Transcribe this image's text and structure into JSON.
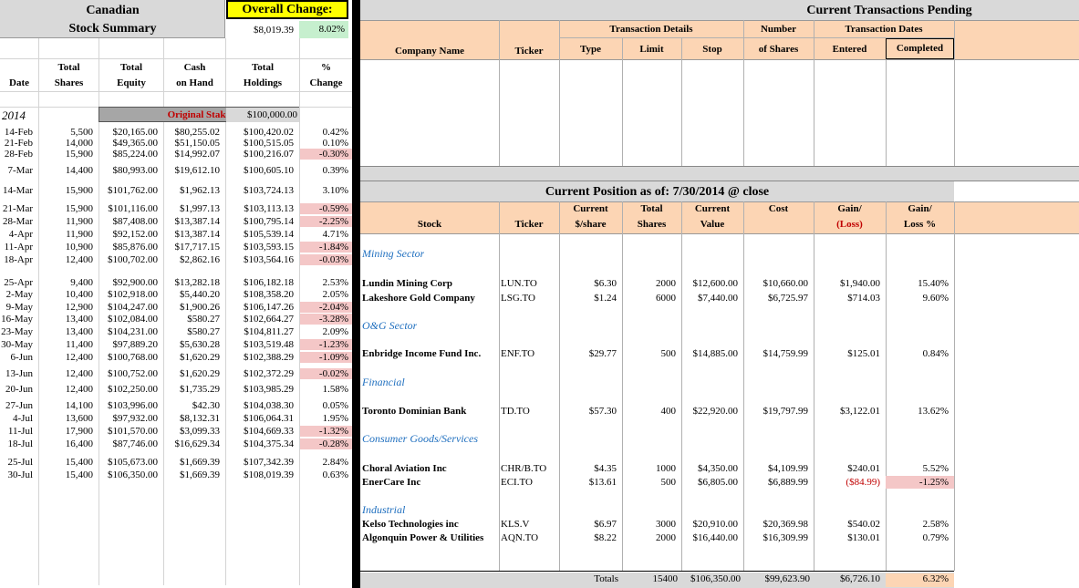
{
  "summary": {
    "title_line1": "Canadian",
    "title_line2": "Stock Summary",
    "overall_label": "Overall Change:",
    "overall_value": "$8,019.39",
    "overall_pct": "8.02%",
    "headers": {
      "date": "Date",
      "shares1": "Total",
      "shares2": "Shares",
      "equity1": "Total",
      "equity2": "Equity",
      "cash1": "Cash",
      "cash2": "on Hand",
      "holdings1": "Total",
      "holdings2": "Holdings",
      "pct1": "%",
      "pct2": "Change"
    },
    "year": "2014",
    "stake_label": "Original Stake:",
    "stake_value": "$100,000.00",
    "rows": [
      {
        "date": "14-Feb",
        "shares": "5,500",
        "equity": "$20,165.00",
        "cash": "$80,255.02",
        "holdings": "$100,420.02",
        "pct": "0.42%",
        "neg": false
      },
      {
        "date": "21-Feb",
        "shares": "14,000",
        "equity": "$49,365.00",
        "cash": "$51,150.05",
        "holdings": "$100,515.05",
        "pct": "0.10%",
        "neg": false
      },
      {
        "date": "28-Feb",
        "shares": "15,900",
        "equity": "$85,224.00",
        "cash": "$14,992.07",
        "holdings": "$100,216.07",
        "pct": "-0.30%",
        "neg": true
      },
      {
        "date": "7-Mar",
        "shares": "14,400",
        "equity": "$80,993.00",
        "cash": "$19,612.10",
        "holdings": "$100,605.10",
        "pct": "0.39%",
        "neg": false
      },
      {
        "date": "14-Mar",
        "shares": "15,900",
        "equity": "$101,762.00",
        "cash": "$1,962.13",
        "holdings": "$103,724.13",
        "pct": "3.10%",
        "neg": false
      },
      {
        "date": "21-Mar",
        "shares": "15,900",
        "equity": "$101,116.00",
        "cash": "$1,997.13",
        "holdings": "$103,113.13",
        "pct": "-0.59%",
        "neg": true
      },
      {
        "date": "28-Mar",
        "shares": "11,900",
        "equity": "$87,408.00",
        "cash": "$13,387.14",
        "holdings": "$100,795.14",
        "pct": "-2.25%",
        "neg": true
      },
      {
        "date": "4-Apr",
        "shares": "11,900",
        "equity": "$92,152.00",
        "cash": "$13,387.14",
        "holdings": "$105,539.14",
        "pct": "4.71%",
        "neg": false
      },
      {
        "date": "11-Apr",
        "shares": "10,900",
        "equity": "$85,876.00",
        "cash": "$17,717.15",
        "holdings": "$103,593.15",
        "pct": "-1.84%",
        "neg": true
      },
      {
        "date": "18-Apr",
        "shares": "12,400",
        "equity": "$100,702.00",
        "cash": "$2,862.16",
        "holdings": "$103,564.16",
        "pct": "-0.03%",
        "neg": true
      },
      {
        "date": "25-Apr",
        "shares": "9,400",
        "equity": "$92,900.00",
        "cash": "$13,282.18",
        "holdings": "$106,182.18",
        "pct": "2.53%",
        "neg": false
      },
      {
        "date": "2-May",
        "shares": "10,400",
        "equity": "$102,918.00",
        "cash": "$5,440.20",
        "holdings": "$108,358.20",
        "pct": "2.05%",
        "neg": false
      },
      {
        "date": "9-May",
        "shares": "12,900",
        "equity": "$104,247.00",
        "cash": "$1,900.26",
        "holdings": "$106,147.26",
        "pct": "-2.04%",
        "neg": true
      },
      {
        "date": "16-May",
        "shares": "13,400",
        "equity": "$102,084.00",
        "cash": "$580.27",
        "holdings": "$102,664.27",
        "pct": "-3.28%",
        "neg": true
      },
      {
        "date": "23-May",
        "shares": "13,400",
        "equity": "$104,231.00",
        "cash": "$580.27",
        "holdings": "$104,811.27",
        "pct": "2.09%",
        "neg": false
      },
      {
        "date": "30-May",
        "shares": "11,400",
        "equity": "$97,889.20",
        "cash": "$5,630.28",
        "holdings": "$103,519.48",
        "pct": "-1.23%",
        "neg": true
      },
      {
        "date": "6-Jun",
        "shares": "12,400",
        "equity": "$100,768.00",
        "cash": "$1,620.29",
        "holdings": "$102,388.29",
        "pct": "-1.09%",
        "neg": true
      },
      {
        "date": "13-Jun",
        "shares": "12,400",
        "equity": "$100,752.00",
        "cash": "$1,620.29",
        "holdings": "$102,372.29",
        "pct": "-0.02%",
        "neg": true
      },
      {
        "date": "20-Jun",
        "shares": "12,400",
        "equity": "$102,250.00",
        "cash": "$1,735.29",
        "holdings": "$103,985.29",
        "pct": "1.58%",
        "neg": false
      },
      {
        "date": "27-Jun",
        "shares": "14,100",
        "equity": "$103,996.00",
        "cash": "$42.30",
        "holdings": "$104,038.30",
        "pct": "0.05%",
        "neg": false
      },
      {
        "date": "4-Jul",
        "shares": "13,600",
        "equity": "$97,932.00",
        "cash": "$8,132.31",
        "holdings": "$106,064.31",
        "pct": "1.95%",
        "neg": false
      },
      {
        "date": "11-Jul",
        "shares": "17,900",
        "equity": "$101,570.00",
        "cash": "$3,099.33",
        "holdings": "$104,669.33",
        "pct": "-1.32%",
        "neg": true
      },
      {
        "date": "18-Jul",
        "shares": "16,400",
        "equity": "$87,746.00",
        "cash": "$16,629.34",
        "holdings": "$104,375.34",
        "pct": "-0.28%",
        "neg": true
      },
      {
        "date": "25-Jul",
        "shares": "15,400",
        "equity": "$105,673.00",
        "cash": "$1,669.39",
        "holdings": "$107,342.39",
        "pct": "2.84%",
        "neg": false
      },
      {
        "date": "30-Jul",
        "shares": "15,400",
        "equity": "$106,350.00",
        "cash": "$1,669.39",
        "holdings": "$108,019.39",
        "pct": "0.63%",
        "neg": false
      }
    ]
  },
  "pending": {
    "title": "Current Transactions Pending",
    "group_details": "Transaction Details",
    "group_number": "Number",
    "group_dates": "Transaction Dates",
    "col_company": "Company Name",
    "col_ticker": "Ticker",
    "col_type": "Type",
    "col_limit": "Limit",
    "col_stop": "Stop",
    "col_shares": "of Shares",
    "col_entered": "Entered",
    "col_completed": "Completed"
  },
  "position": {
    "title": "Current Position as of: 7/30/2014  @ close",
    "col_stock": "Stock",
    "col_ticker": "Ticker",
    "col_price1": "Current",
    "col_price2": "$/share",
    "col_shares1": "Total",
    "col_shares2": "Shares",
    "col_value1": "Current",
    "col_value2": "Value",
    "col_cost": "Cost",
    "col_gain1": "Gain/",
    "col_gain2": "(Loss)",
    "col_gainpct1": "Gain/",
    "col_gainpct2": "Loss %",
    "sectors": {
      "mining": "Mining Sector",
      "og": "O&G Sector",
      "financial": "Financial",
      "consumer": "Consumer Goods/Services",
      "industrial": "Industrial"
    },
    "stocks": [
      {
        "name": "Lundin Mining Corp",
        "ticker": "LUN.TO",
        "price": "$6.30",
        "shares": "2000",
        "value": "$12,600.00",
        "cost": "$10,660.00",
        "gain": "$1,940.00",
        "pct": "15.40%",
        "loss": false
      },
      {
        "name": "Lakeshore Gold Company",
        "ticker": "LSG.TO",
        "price": "$1.24",
        "shares": "6000",
        "value": "$7,440.00",
        "cost": "$6,725.97",
        "gain": "$714.03",
        "pct": "9.60%",
        "loss": false
      },
      {
        "name": "Enbridge Income Fund Inc.",
        "ticker": "ENF.TO",
        "price": "$29.77",
        "shares": "500",
        "value": "$14,885.00",
        "cost": "$14,759.99",
        "gain": "$125.01",
        "pct": "0.84%",
        "loss": false
      },
      {
        "name": "Toronto Dominian Bank",
        "ticker": "TD.TO",
        "price": "$57.30",
        "shares": "400",
        "value": "$22,920.00",
        "cost": "$19,797.99",
        "gain": "$3,122.01",
        "pct": "13.62%",
        "loss": false
      },
      {
        "name": "Choral Aviation Inc",
        "ticker": "CHR/B.TO",
        "price": "$4.35",
        "shares": "1000",
        "value": "$4,350.00",
        "cost": "$4,109.99",
        "gain": "$240.01",
        "pct": "5.52%",
        "loss": false
      },
      {
        "name": "EnerCare Inc",
        "ticker": "ECI.TO",
        "price": "$13.61",
        "shares": "500",
        "value": "$6,805.00",
        "cost": "$6,889.99",
        "gain": "($84.99)",
        "pct": "-1.25%",
        "loss": true
      },
      {
        "name": "Kelso Technologies inc",
        "ticker": "KLS.V",
        "price": "$6.97",
        "shares": "3000",
        "value": "$20,910.00",
        "cost": "$20,369.98",
        "gain": "$540.02",
        "pct": "2.58%",
        "loss": false
      },
      {
        "name": "Algonquin Power & Utilities",
        "ticker": "AQN.TO",
        "price": "$8.22",
        "shares": "2000",
        "value": "$16,440.00",
        "cost": "$16,309.99",
        "gain": "$130.01",
        "pct": "0.79%",
        "loss": false
      }
    ],
    "totals": {
      "label": "Totals",
      "shares": "15400",
      "value": "$106,350.00",
      "cost": "$99,623.90",
      "gain": "$6,726.10",
      "pct": "6.32%"
    }
  },
  "colors": {
    "orange": "#fcd5b4",
    "gray": "#d9d9d9",
    "yellow": "#ffff00",
    "green": "#c6efce",
    "pink": "#f4c7c7",
    "loss_red": "#c00000",
    "sector_blue": "#1f6fbf"
  }
}
